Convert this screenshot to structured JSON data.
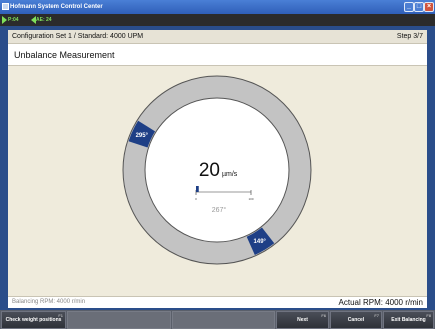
{
  "window": {
    "title": "Hofmann System Control Center",
    "min_label": "_",
    "max_label": "□",
    "close_label": "×"
  },
  "indicators": [
    {
      "text": "P:04"
    },
    {
      "text": "AE: 24"
    }
  ],
  "header": {
    "config": "Configuration Set 1 / Standard: 4000 UPM",
    "step": "Step 3/7"
  },
  "section": {
    "title": "Unbalance Measurement"
  },
  "measurement": {
    "value": "20",
    "unit": "µm/s",
    "angle_text": "267°",
    "scale_min": "0",
    "scale_max": "100",
    "scale_level": 0.05,
    "markers": [
      {
        "label": "295°",
        "angle_deg": 295
      },
      {
        "label": "149°",
        "angle_deg": 149
      }
    ]
  },
  "footer": {
    "balancing_rpm": "Balancing RPM: 4000 r/min",
    "actual_rpm": "Actual RPM:  4000 r/min"
  },
  "buttons": [
    {
      "label": "Check weight positions",
      "fkey": "F1"
    },
    {
      "label": "",
      "fkey": ""
    },
    {
      "label": "",
      "fkey": ""
    },
    {
      "label": "Next",
      "fkey": "F6"
    },
    {
      "label": "Cancel",
      "fkey": "F7"
    },
    {
      "label": "Exit Balancing",
      "fkey": "F8"
    }
  ],
  "colors": {
    "ring": "#c3c3c3",
    "ring_stroke": "#555555",
    "marker": "#1e3f86",
    "indicator": "#7fe05a"
  }
}
